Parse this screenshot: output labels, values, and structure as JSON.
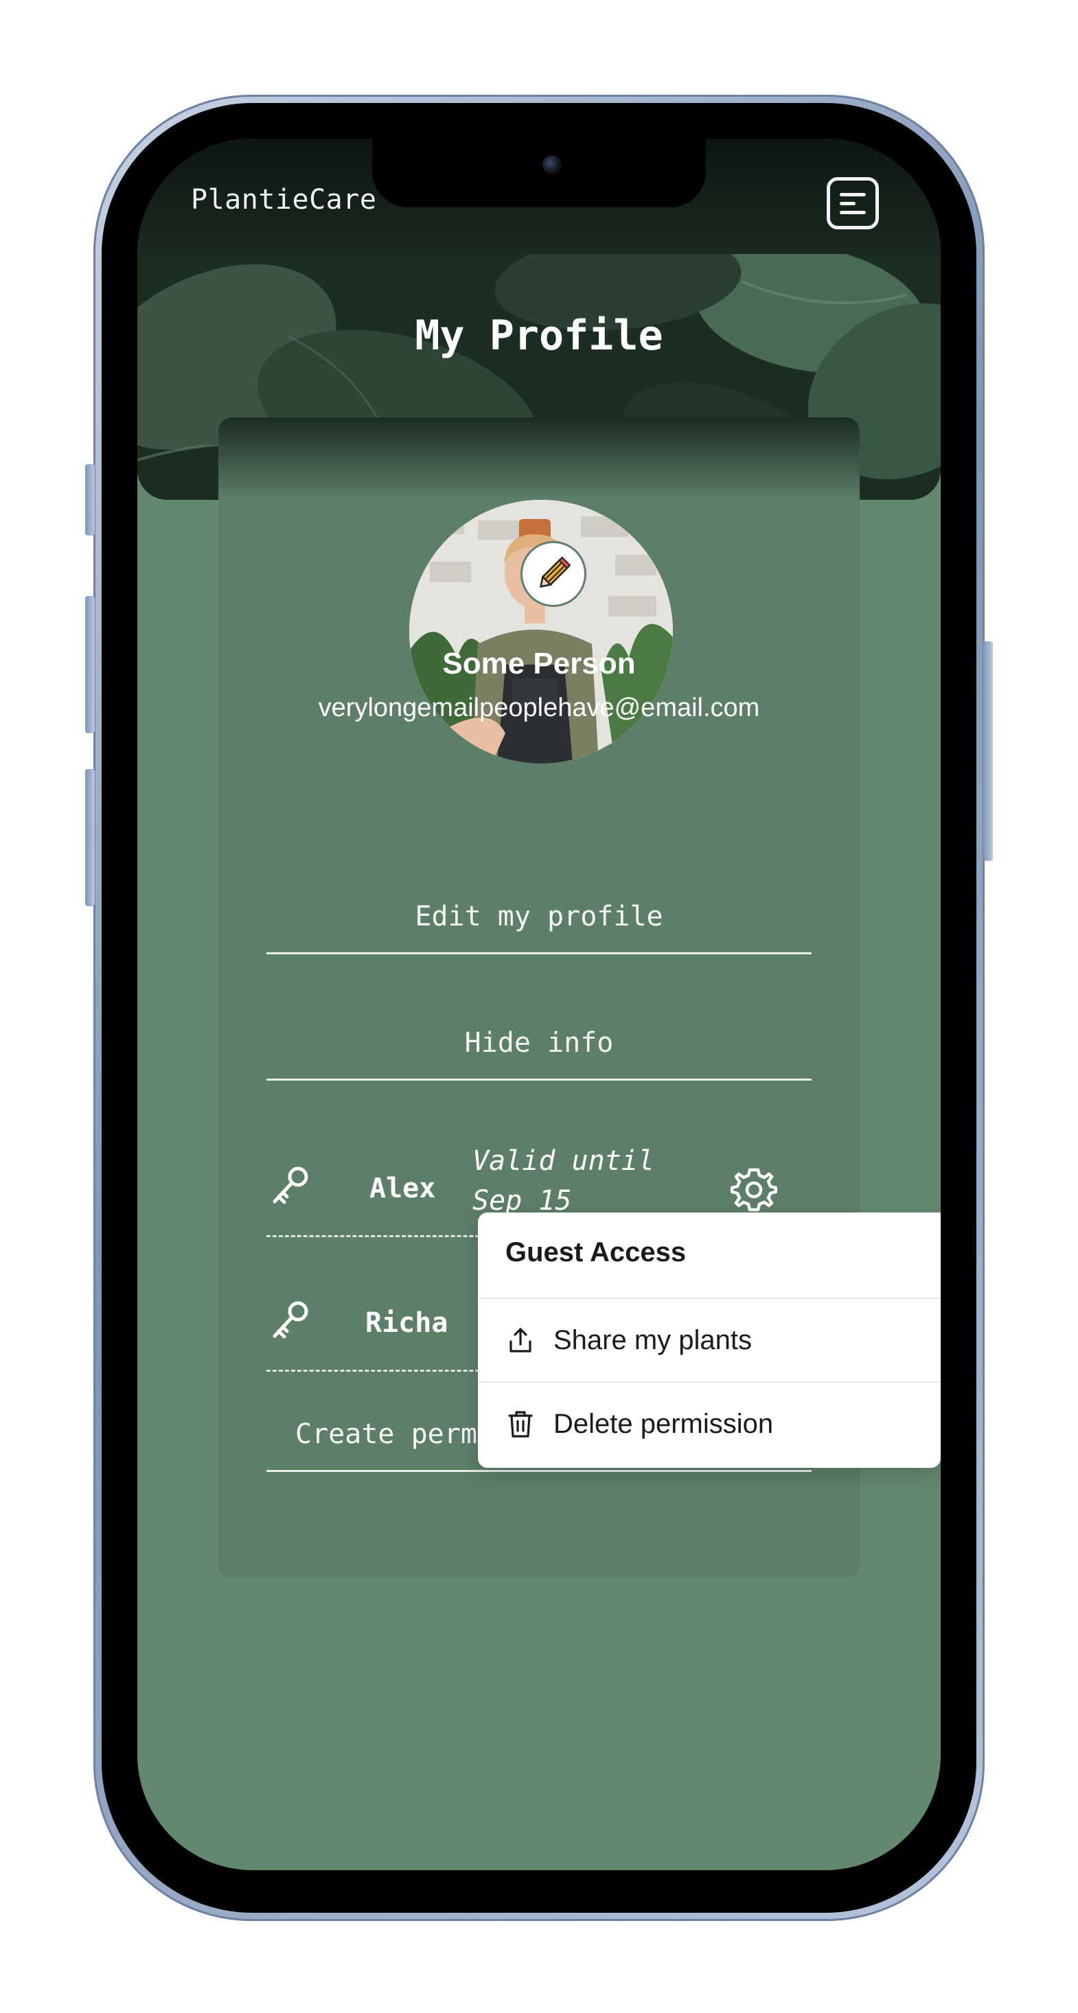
{
  "app": {
    "brand": "PlantieCare",
    "page_title": "My Profile"
  },
  "profile": {
    "name": "Some Person",
    "email": "verylongemailpeoplehave@email.com",
    "edit_label": "Edit my profile",
    "hide_label": "Hide info"
  },
  "permissions": [
    {
      "name": "Alex",
      "valid_line1": "Valid until",
      "valid_line2": "Sep 15"
    },
    {
      "name": "Richa"
    }
  ],
  "create_permission_label": "Create perm",
  "popup": {
    "title": "Guest Access",
    "items": [
      {
        "label": "Share my plants",
        "icon": "share-icon"
      },
      {
        "label": "Delete permission",
        "icon": "trash-icon"
      }
    ]
  },
  "icons": {
    "menu": "menu-icon",
    "edit_avatar": "pencil-icon",
    "permission": "key-icon",
    "settings": "gear-icon"
  },
  "colors": {
    "background": "#64886e",
    "card": "#5d7e69",
    "nav": "#0d1611",
    "text_light": "#ffffff",
    "popup_bg": "#ffffff",
    "pencil_accent": "#e9a93c"
  }
}
